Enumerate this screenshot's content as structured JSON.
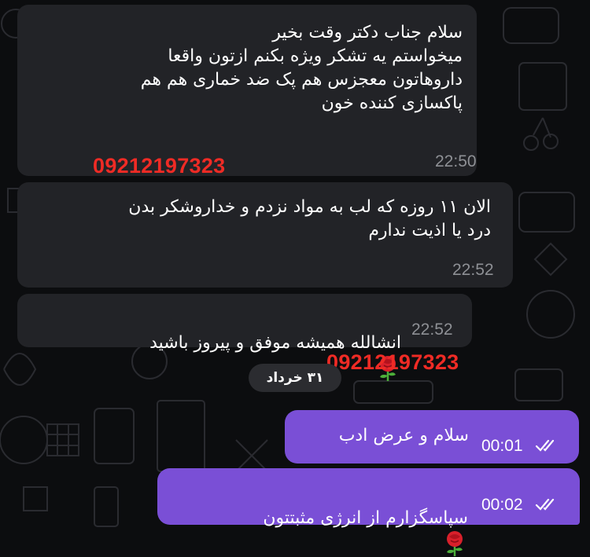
{
  "messages": [
    {
      "text": "سلام جناب دکتر وقت بخیر\nمیخواستم یه تشکر ویژه بکنم ازتون واقعا\nداروهاتون معجزس هم پک ضد خماری هم هم\nپاکسازی کننده خون",
      "time": "22:50"
    },
    {
      "text": "الان ۱۱ روزه که لب به مواد نزدم و خداروشکر بدن\nدرد یا اذیت ندارم",
      "time": "22:52"
    },
    {
      "text": "انشالله همیشه موفق و پیروز باشید",
      "emoji": "rose-emoji",
      "time": "22:52"
    },
    {
      "text": "سلام و عرض ادب",
      "time": "00:01",
      "status": "read"
    },
    {
      "text": "سپاسگزارم از انرژی مثبتتون",
      "emoji": "rose-emoji",
      "time": "00:02",
      "status": "read"
    }
  ],
  "date_separator": "۳۱ خرداد",
  "overlay_phone_1": "09212197323",
  "overlay_phone_2": "09212197323",
  "colors": {
    "background": "#0c0d0f",
    "incoming_bubble": "#222327",
    "outgoing_bubble": "#7a4fd6",
    "overlay_text": "#ef2b25"
  }
}
